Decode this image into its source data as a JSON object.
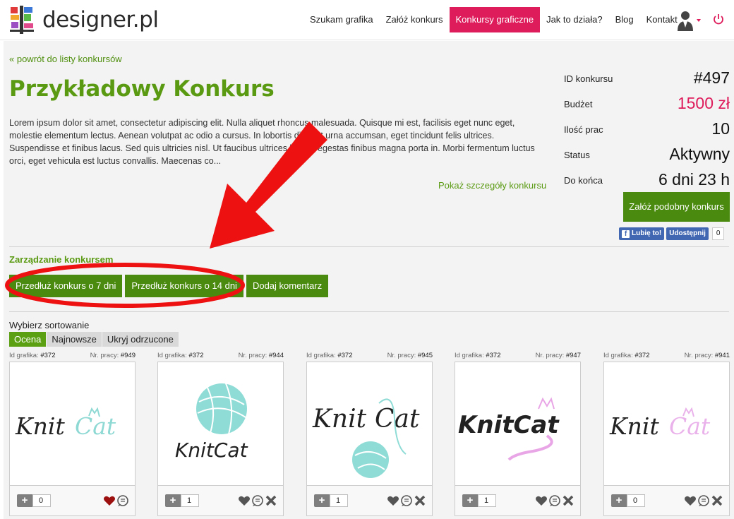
{
  "header": {
    "logo_text": "designer.pl",
    "nav": [
      "Szukam grafika",
      "Załóż konkurs",
      "Konkursy graficzne",
      "Jak to działa?",
      "Blog",
      "Kontakt"
    ],
    "active_nav": "Konkursy graficzne"
  },
  "contest": {
    "back_link": "« powrót do listy konkursów",
    "title": "Przykładowy Konkurs",
    "description": "Lorem ipsum dolor sit amet, consectetur adipiscing elit. Nulla aliquet rhoncus malesuada. Quisque mi est, facilisis eget nunc eget, molestie elementum lectus. Aenean volutpat ac odio a cursus. In lobortis diam at urna accumsan, eget tincidunt felis ultrices. Suspendisse et finibus lacus. Sed quis ultricies nisl. Ut faucibus ultrices luctus, egestas finibus magna porta in. Morbi fermentum luctus orci, eget vehicula est luctus convallis. Maecenas co...",
    "details_link": "Pokaż szczegóły konkursu"
  },
  "stats": [
    {
      "label": "ID konkursu",
      "value": "#497"
    },
    {
      "label": "Budżet",
      "value": "1500 zł"
    },
    {
      "label": "Ilość prac",
      "value": "10"
    },
    {
      "label": "Status",
      "value": "Aktywny"
    },
    {
      "label": "Do końca",
      "value": "6 dni 23 h"
    }
  ],
  "similar_button": "Załóż podobny konkurs",
  "social": {
    "like": "Lubię to!",
    "share": "Udostępnij",
    "count": "0"
  },
  "management": {
    "title": "Zarządzanie konkursem",
    "buttons": [
      "Przedłuż konkurs o 7 dni",
      "Przedłuż konkurs o 14 dni",
      "Dodaj komentarz"
    ]
  },
  "sorting": {
    "label": "Wybierz sortowanie",
    "tabs": [
      "Ocena",
      "Najnowsze",
      "Ukryj odrzucone"
    ],
    "active": "Ocena"
  },
  "cards": [
    {
      "designer_label": "Id grafika:",
      "designer_id": "#372",
      "work_label": "Nr. pracy:",
      "work_id": "#949",
      "votes": "0",
      "logo": "KnitCat",
      "favorited": true,
      "rejectable": false
    },
    {
      "designer_label": "Id grafika:",
      "designer_id": "#372",
      "work_label": "Nr. pracy:",
      "work_id": "#944",
      "votes": "1",
      "logo": "KnitCat",
      "favorited": false,
      "rejectable": true
    },
    {
      "designer_label": "Id grafika:",
      "designer_id": "#372",
      "work_label": "Nr. pracy:",
      "work_id": "#945",
      "votes": "1",
      "logo": "KnitCat",
      "favorited": false,
      "rejectable": true
    },
    {
      "designer_label": "Id grafika:",
      "designer_id": "#372",
      "work_label": "Nr. pracy:",
      "work_id": "#947",
      "votes": "1",
      "logo": "KnitCat",
      "favorited": false,
      "rejectable": true
    },
    {
      "designer_label": "Id grafika:",
      "designer_id": "#372",
      "work_label": "Nr. pracy:",
      "work_id": "#941",
      "votes": "0",
      "logo": "KnitCat",
      "favorited": false,
      "rejectable": true
    }
  ],
  "colors": {
    "brand_green": "#5a9a12",
    "button_green": "#4a8a0e",
    "accent_pink": "#de1b5b",
    "annotation_red": "#ee1111"
  }
}
